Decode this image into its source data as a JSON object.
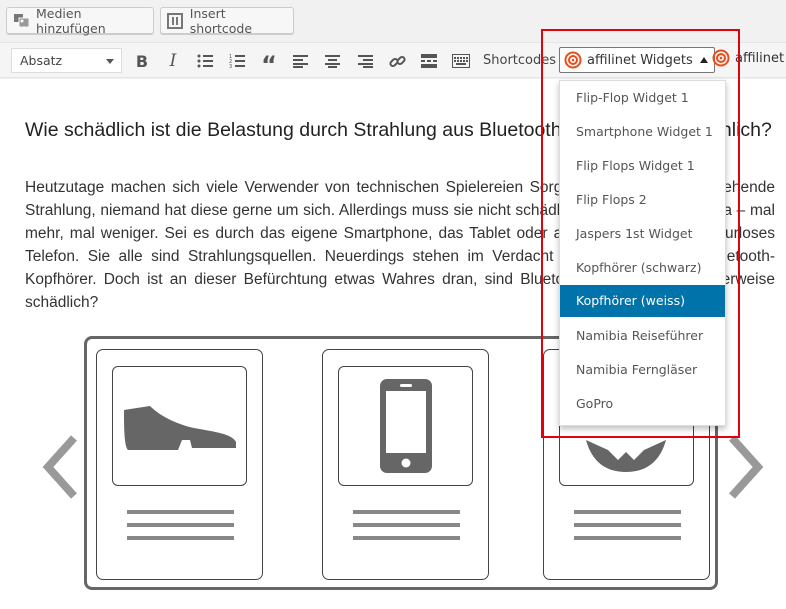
{
  "media_bar": {
    "add_media": "Medien hinzufügen",
    "insert_shortcode": "Insert shortcode"
  },
  "toolbar": {
    "format_select": "Absatz",
    "buttons": [
      "bold-icon",
      "italic-icon",
      "bullet-list-icon",
      "numbered-list-icon",
      "blockquote-icon",
      "align-left-icon",
      "align-center-icon",
      "align-right-icon",
      "link-icon",
      "read-more-icon",
      "toolbar-toggle-icon"
    ],
    "shortcodes_label": "Shortcodes",
    "affilinet_widgets_label": "affilinet Widgets",
    "affilinet_truncated_label": "affilinet P"
  },
  "editor": {
    "heading": "Wie schädlich ist die Belastung durch Strahlung aus Bluetooth Kopfhörern tatsächlich?",
    "paragraph": "Heutzutage machen sich viele Verwender von technischen Spielereien Sorgen um die davon ausgehende Strahlung, niemand hat diese gerne um sich. Allerdings muss sie nicht schädlich sein: sie ist immer da – mal mehr, mal weniger. Sei es durch das eigene Smartphone, das Tablet oder auch ein einfaches schnurloses Telefon. Sie alle sind Strahlungsquellen. Neuerdings stehen im Verdacht auch die beliebten Bluetooth-Kopfhörer. Doch ist an dieser Befürchtung etwas Wahres dran, sind Bluetooth Kopfhörer möglicherweise schädlich?"
  },
  "dropdown": {
    "items": [
      {
        "label": "Flip-Flop Widget 1",
        "selected": false
      },
      {
        "label": "Smartphone Widget 1",
        "selected": false
      },
      {
        "label": "Flip Flops Widget 1",
        "selected": false
      },
      {
        "label": "Flip Flops 2",
        "selected": false
      },
      {
        "label": "Jaspers 1st Widget",
        "selected": false
      },
      {
        "label": "Kopfhörer (schwarz)",
        "selected": false
      },
      {
        "label": "Kopfhörer (weiss)",
        "selected": true
      },
      {
        "label": "Namibia Reiseführer",
        "selected": false
      },
      {
        "label": "Namibia Ferngläser",
        "selected": false
      },
      {
        "label": "GoPro",
        "selected": false
      }
    ]
  },
  "colors": {
    "selected_item": "#0073aa",
    "highlight_border": "#e3000f",
    "affilinet_icon": "#e94e1b"
  }
}
